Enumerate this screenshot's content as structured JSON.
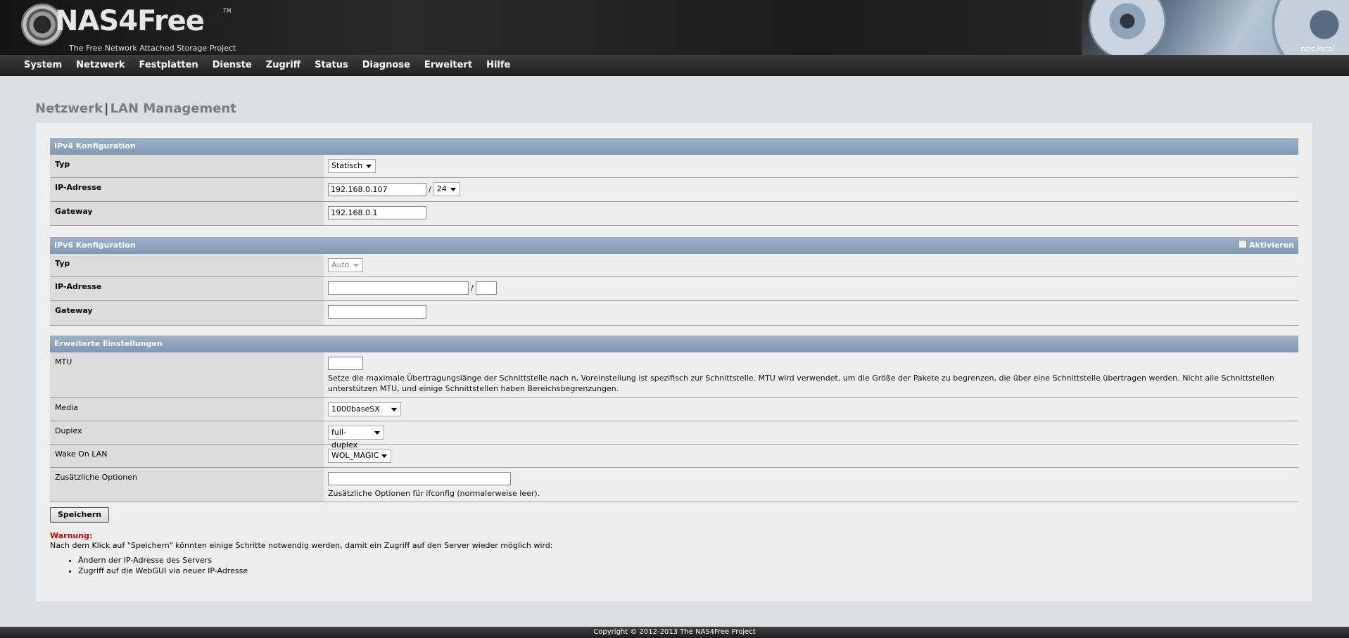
{
  "header": {
    "brand": "NAS4Free",
    "trademark": "TM",
    "tagline": "The Free Network Attached Storage Project",
    "hostname": "nas.local"
  },
  "nav": {
    "items": [
      "System",
      "Netzwerk",
      "Festplatten",
      "Dienste",
      "Zugriff",
      "Status",
      "Diagnose",
      "Erweitert",
      "Hilfe"
    ]
  },
  "page": {
    "title_part1": "Netzwerk",
    "title_sep": "|",
    "title_part2": "LAN Management"
  },
  "ipv4": {
    "heading": "IPv4 Konfiguration",
    "type_label": "Typ",
    "type_value": "Statisch",
    "ip_label": "IP-Adresse",
    "ip_value": "192.168.0.107",
    "slash": "/",
    "mask_value": "24",
    "gateway_label": "Gateway",
    "gateway_value": "192.168.0.1"
  },
  "ipv6": {
    "heading": "IPv6 Konfiguration",
    "activate_label": "Aktivieren",
    "activate_checked": false,
    "type_label": "Typ",
    "type_value": "Auto",
    "ip_label": "IP-Adresse",
    "ip_value": "",
    "slash": "/",
    "prefix_value": "",
    "gateway_label": "Gateway",
    "gateway_value": ""
  },
  "advanced": {
    "heading": "Erweiterte Einstellungen",
    "mtu_label": "MTU",
    "mtu_value": "",
    "mtu_desc": "Setze die maximale Übertragungslänge der Schnittstelle nach n, Voreinstellung ist spezifisch zur Schnittstelle. MTU wird verwendet, um die Größe der Pakete zu begrenzen, die über eine Schnittstelle übertragen werden. Nicht alle Schnittstellen unterstützen MTU, und einige Schnittstellen haben Bereichsbegrenzungen.",
    "media_label": "Media",
    "media_value": "1000baseSX",
    "duplex_label": "Duplex",
    "duplex_value": "full-duplex",
    "wol_label": "Wake On LAN",
    "wol_value": "WOL_MAGIC",
    "options_label": "Zusätzliche Optionen",
    "options_value": "",
    "options_desc": "Zusätzliche Optionen für ifconfig (normalerweise leer)."
  },
  "actions": {
    "save_label": "Speichern"
  },
  "warning": {
    "title": "Warnung:",
    "text": "Nach dem Klick auf \"Speichern\" könnten einige Schritte notwendig werden, damit ein Zugriff auf den Server wieder möglich wird:",
    "items": [
      "Ändern der IP-Adresse des Servers",
      "Zugriff auf die WebGUI via neuer IP-Adresse"
    ]
  },
  "footer": {
    "copyright": "Copyright © 2012-2013 The NAS4Free Project"
  }
}
